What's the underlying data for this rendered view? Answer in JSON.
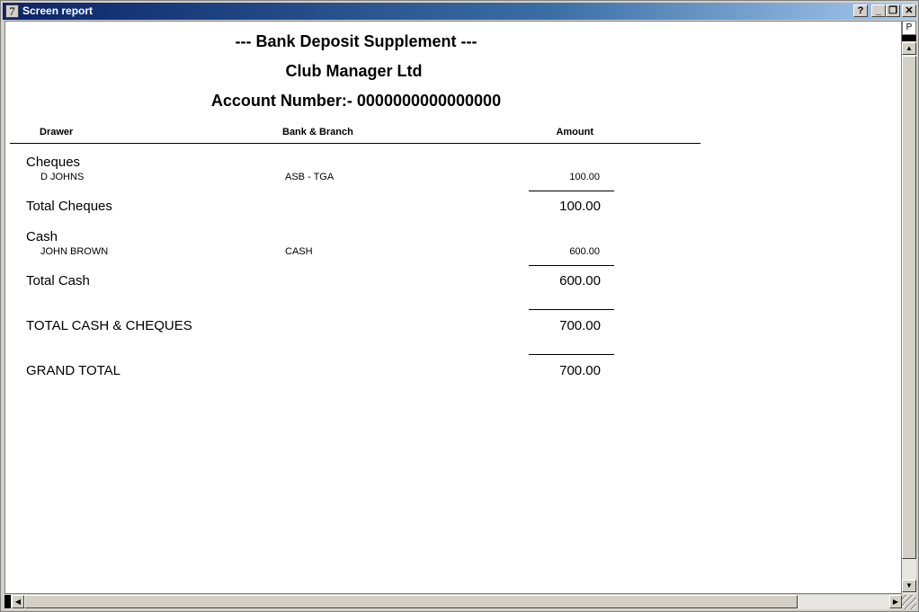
{
  "window": {
    "title": "Screen report",
    "icon_glyph": "7",
    "buttons": {
      "help": "?",
      "minimize": "_",
      "restore": "❐",
      "close": "✕"
    }
  },
  "report": {
    "title": "---  Bank Deposit Supplement  ---",
    "company": "Club Manager Ltd",
    "account_line": "Account Number:-  0000000000000000",
    "columns": {
      "drawer": "Drawer",
      "bank_branch": "Bank & Branch",
      "amount": "Amount"
    },
    "cheques": {
      "heading": "Cheques",
      "rows": [
        {
          "drawer": "D JOHNS",
          "bank": "ASB - TGA",
          "amount": "100.00"
        }
      ],
      "total_label": "Total Cheques",
      "total_value": "100.00"
    },
    "cash": {
      "heading": "Cash",
      "rows": [
        {
          "drawer": "JOHN BROWN",
          "bank": "CASH",
          "amount": "600.00"
        }
      ],
      "total_label": "Total Cash",
      "total_value": "600.00"
    },
    "total_cash_cheques_label": "TOTAL CASH & CHEQUES",
    "total_cash_cheques_value": "700.00",
    "grand_total_label": "GRAND TOTAL",
    "grand_total_value": "700.00"
  },
  "scrollbar": {
    "vertical_label": "P",
    "up_glyph": "▲",
    "down_glyph": "▼",
    "left_glyph": "◀",
    "right_glyph": "▶"
  }
}
